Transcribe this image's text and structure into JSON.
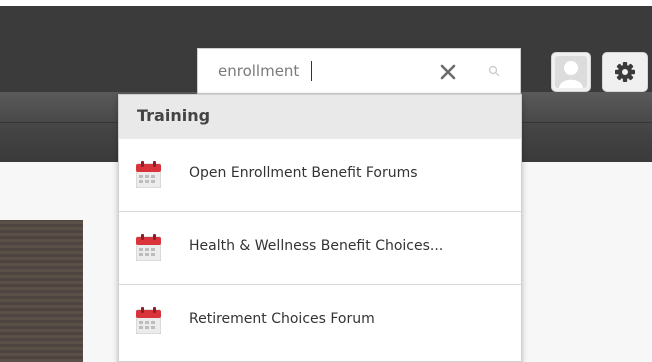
{
  "search": {
    "value": "enrollment",
    "clear_icon": "close-icon",
    "search_icon": "search-icon"
  },
  "header": {
    "avatar_icon": "user-avatar-icon",
    "settings_icon": "gear-icon"
  },
  "dropdown": {
    "category": "Training",
    "results": [
      {
        "label": "Open Enrollment Benefit Forums",
        "icon": "calendar-icon"
      },
      {
        "label": "Health & Wellness Benefit Choices...",
        "icon": "calendar-icon"
      },
      {
        "label": "Retirement Choices Forum",
        "icon": "calendar-icon"
      }
    ]
  },
  "colors": {
    "header_bg": "#3b3b3b",
    "calendar_red": "#d9333c"
  }
}
